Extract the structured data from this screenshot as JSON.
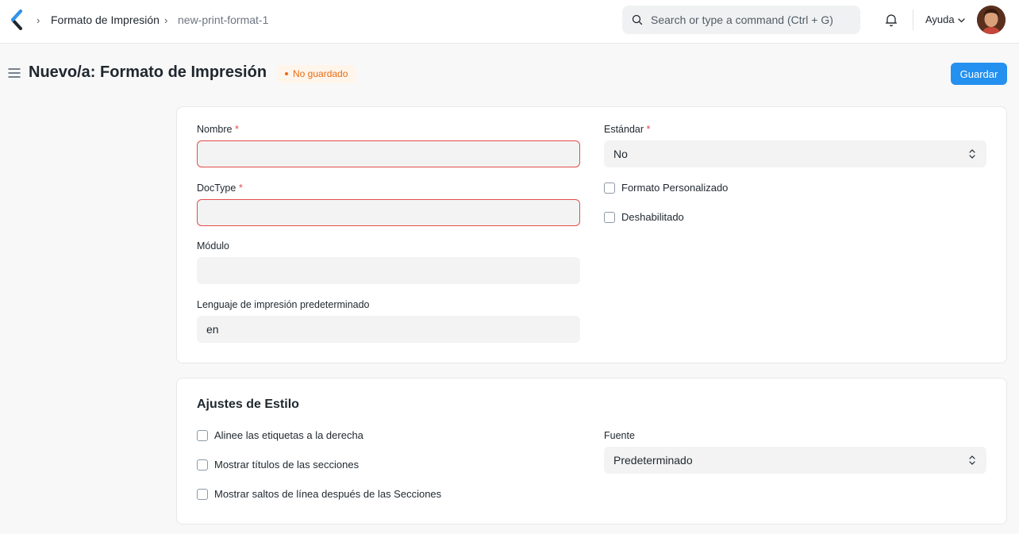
{
  "breadcrumb": {
    "items": [
      "Formato de Impresión",
      "new-print-format-1"
    ]
  },
  "search": {
    "placeholder": "Search or type a command (Ctrl + G)"
  },
  "navbar": {
    "help_label": "Ayuda"
  },
  "page": {
    "title": "Nuevo/a: Formato de Impresión",
    "status": "No guardado",
    "save_label": "Guardar"
  },
  "form": {
    "nombre": {
      "label": "Nombre",
      "required": "*",
      "value": ""
    },
    "doctype": {
      "label": "DocType",
      "required": "*",
      "value": ""
    },
    "modulo": {
      "label": "Módulo",
      "value": ""
    },
    "lenguaje": {
      "label": "Lenguaje de impresión predeterminado",
      "value": "en"
    },
    "estandar": {
      "label": "Estándar",
      "required": "*",
      "value": "No"
    },
    "formato_personalizado": {
      "label": "Formato Personalizado"
    },
    "deshabilitado": {
      "label": "Deshabilitado"
    }
  },
  "style_section": {
    "title": "Ajustes de Estilo",
    "align_labels": "Alinee las etiquetas a la derecha",
    "show_section_titles": "Mostrar títulos de las secciones",
    "show_line_breaks": "Mostrar saltos de línea después de las Secciones",
    "fuente": {
      "label": "Fuente",
      "value": "Predeterminado"
    }
  },
  "colors": {
    "primary": "#2490ef",
    "error": "#e24c4c",
    "status": "#e86c13"
  }
}
